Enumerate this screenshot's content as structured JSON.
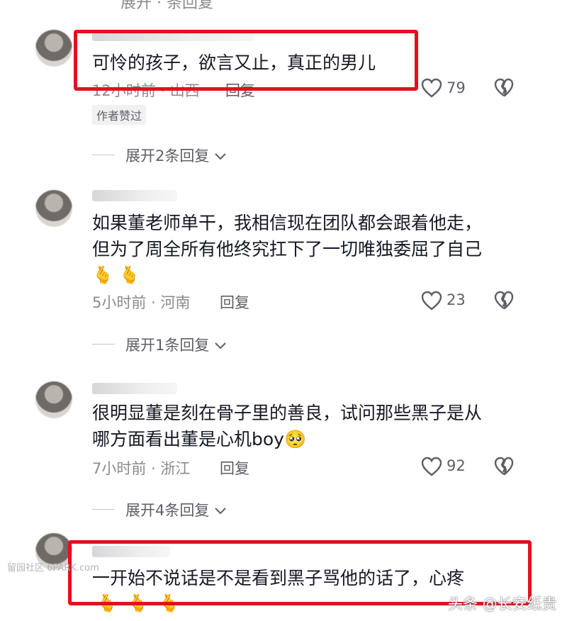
{
  "top_partial": "展开 · 条回复",
  "comments": [
    {
      "text_lines": [
        "可怜的孩子，欲言又止，真正的男儿"
      ],
      "emojis": "",
      "time": "12小时前",
      "location": "山西",
      "reply": "回复",
      "likes": "79",
      "badge": "作者赞过",
      "expand": "展开2条回复"
    },
    {
      "text_lines": [
        "如果董老师单干，我相信现在团队都会跟着他走，",
        "但为了周全所有他终究扛下了一切唯独委屈了自己"
      ],
      "emojis": "🫰🫰",
      "time": "5小时前",
      "location": "河南",
      "reply": "回复",
      "likes": "23",
      "badge": "",
      "expand": "展开1条回复"
    },
    {
      "text_lines": [
        "很明显董是刻在骨子里的善良，试问那些黑子是从",
        "哪方面看出董是心机boy🥺"
      ],
      "emojis": "",
      "time": "7小时前",
      "location": "浙江",
      "reply": "回复",
      "likes": "92",
      "badge": "",
      "expand": "展开4条回复"
    },
    {
      "text_lines": [
        "一开始不说话是不是看到黑子骂他的话了，心疼"
      ],
      "emojis": "🫰🫰🫰",
      "time": "",
      "location": "",
      "reply": "",
      "likes": "",
      "badge": "",
      "expand": ""
    }
  ],
  "watermark_left": "留园社区 6PARK.com",
  "watermark_right": "头条 @长安纸贵",
  "colors": {
    "highlight": "#e3101e",
    "meta": "#8a8b91",
    "text": "#161823"
  },
  "icons": {
    "like": "heart-outline-icon",
    "dislike": "broken-heart-icon",
    "expand": "chevron-down-icon"
  }
}
